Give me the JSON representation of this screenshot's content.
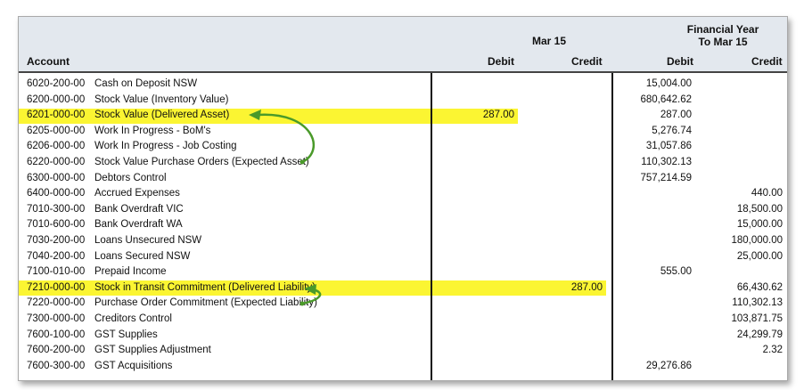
{
  "header": {
    "period_label": "Mar 15",
    "fy_line1": "Financial Year",
    "fy_line2": "To Mar 15",
    "col_account": "Account",
    "col_debit": "Debit",
    "col_credit": "Credit",
    "col_fy_debit": "Debit",
    "col_fy_credit": "Credit"
  },
  "highlight_color": "#fbf532",
  "arrow_color": "#4a9a2a",
  "rows": [
    {
      "account": "6020-200-00",
      "name": "Cash on Deposit NSW",
      "mar_debit": "",
      "mar_credit": "",
      "fy_debit": "15,004.00",
      "fy_credit": "",
      "highlight": false
    },
    {
      "account": "6200-000-00",
      "name": "Stock Value (Inventory Value)",
      "mar_debit": "",
      "mar_credit": "",
      "fy_debit": "680,642.62",
      "fy_credit": "",
      "highlight": false
    },
    {
      "account": "6201-000-00",
      "name": "Stock Value (Delivered Asset)",
      "mar_debit": "287.00",
      "mar_credit": "",
      "fy_debit": "287.00",
      "fy_credit": "",
      "highlight": true
    },
    {
      "account": "6205-000-00",
      "name": "Work In Progress - BoM's",
      "mar_debit": "",
      "mar_credit": "",
      "fy_debit": "5,276.74",
      "fy_credit": "",
      "highlight": false
    },
    {
      "account": "6206-000-00",
      "name": "Work In Progress - Job Costing",
      "mar_debit": "",
      "mar_credit": "",
      "fy_debit": "31,057.86",
      "fy_credit": "",
      "highlight": false
    },
    {
      "account": "6220-000-00",
      "name": "Stock Value Purchase Orders (Expected Asset)",
      "mar_debit": "",
      "mar_credit": "",
      "fy_debit": "110,302.13",
      "fy_credit": "",
      "highlight": false
    },
    {
      "account": "6300-000-00",
      "name": "Debtors Control",
      "mar_debit": "",
      "mar_credit": "",
      "fy_debit": "757,214.59",
      "fy_credit": "",
      "highlight": false
    },
    {
      "account": "6400-000-00",
      "name": "Accrued Expenses",
      "mar_debit": "",
      "mar_credit": "",
      "fy_debit": "",
      "fy_credit": "440.00",
      "highlight": false
    },
    {
      "account": "7010-300-00",
      "name": "Bank Overdraft VIC",
      "mar_debit": "",
      "mar_credit": "",
      "fy_debit": "",
      "fy_credit": "18,500.00",
      "highlight": false
    },
    {
      "account": "7010-600-00",
      "name": "Bank Overdraft WA",
      "mar_debit": "",
      "mar_credit": "",
      "fy_debit": "",
      "fy_credit": "15,000.00",
      "highlight": false
    },
    {
      "account": "7030-200-00",
      "name": "Loans Unsecured NSW",
      "mar_debit": "",
      "mar_credit": "",
      "fy_debit": "",
      "fy_credit": "180,000.00",
      "highlight": false
    },
    {
      "account": "7040-200-00",
      "name": "Loans Secured NSW",
      "mar_debit": "",
      "mar_credit": "",
      "fy_debit": "",
      "fy_credit": "25,000.00",
      "highlight": false
    },
    {
      "account": "7100-010-00",
      "name": "Prepaid Income",
      "mar_debit": "",
      "mar_credit": "",
      "fy_debit": "555.00",
      "fy_credit": "",
      "highlight": false
    },
    {
      "account": "7210-000-00",
      "name": "Stock in Transit Commitment (Delivered Liability)",
      "mar_debit": "",
      "mar_credit": "287.00",
      "fy_debit": "",
      "fy_credit": "66,430.62",
      "highlight": true
    },
    {
      "account": "7220-000-00",
      "name": "Purchase Order Commitment (Expected Liability)",
      "mar_debit": "",
      "mar_credit": "",
      "fy_debit": "",
      "fy_credit": "110,302.13",
      "highlight": false
    },
    {
      "account": "7300-000-00",
      "name": "Creditors Control",
      "mar_debit": "",
      "mar_credit": "",
      "fy_debit": "",
      "fy_credit": "103,871.75",
      "highlight": false
    },
    {
      "account": "7600-100-00",
      "name": "GST Supplies",
      "mar_debit": "",
      "mar_credit": "",
      "fy_debit": "",
      "fy_credit": "24,299.79",
      "highlight": false
    },
    {
      "account": "7600-200-00",
      "name": "GST Supplies Adjustment",
      "mar_debit": "",
      "mar_credit": "",
      "fy_debit": "",
      "fy_credit": "2.32",
      "highlight": false
    },
    {
      "account": "7600-300-00",
      "name": "GST Acquisitions",
      "mar_debit": "",
      "mar_credit": "",
      "fy_debit": "29,276.86",
      "fy_credit": "",
      "highlight": false
    }
  ]
}
